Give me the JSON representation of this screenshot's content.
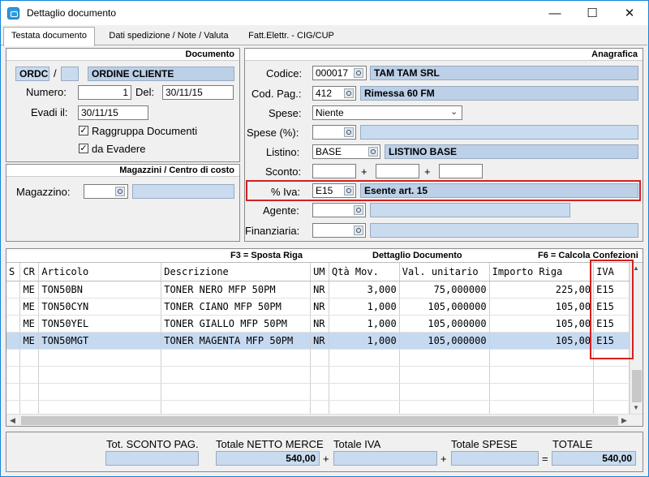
{
  "window": {
    "title": "Dettaglio documento",
    "minimize": "—",
    "maximize": "☐",
    "close": "✕"
  },
  "tabs": [
    {
      "label": "Testata documento",
      "active": true
    },
    {
      "label": "Dati spedizione / Note / Valuta",
      "active": false
    },
    {
      "label": "Fatt.Elettr. - CIG/CUP",
      "active": false
    }
  ],
  "documento": {
    "header": "Documento",
    "tipo": "ORDC",
    "separator": "/",
    "serie": "",
    "descrizione": "ORDINE CLIENTE",
    "numero_label": "Numero:",
    "numero": "1",
    "del_label": "Del:",
    "data": "30/11/15",
    "evadi_label": "Evadi il:",
    "evadi": "30/11/15",
    "raggruppa_label": "Raggruppa Documenti",
    "raggruppa_checked": true,
    "da_evadere_label": "da Evadere",
    "da_evadere_checked": true,
    "check_mark": "✓"
  },
  "magazzini": {
    "header": "Magazzini / Centro di costo",
    "magazzino_label": "Magazzino:",
    "magazzino": "",
    "magazzino_desc": ""
  },
  "anagrafica": {
    "header": "Anagrafica",
    "codice_label": "Codice:",
    "codice": "000017",
    "codice_desc": "TAM TAM SRL",
    "codpag_label": "Cod. Pag.:",
    "codpag": "412",
    "codpag_desc": "Rimessa 60 FM",
    "spese_label": "Spese:",
    "spese": "Niente",
    "spese_perc_label": "Spese (%):",
    "spese_perc": "",
    "listino_label": "Listino:",
    "listino": "BASE",
    "listino_desc": "LISTINO BASE",
    "sconto_label": "Sconto:",
    "sconto_plus": "+",
    "sconto1": "",
    "sconto2": "",
    "sconto3": "",
    "iva_label": "% Iva:",
    "iva": "E15",
    "iva_desc": "Esente art. 15",
    "agente_label": "Agente:",
    "agente": "",
    "finanziaria_label": "Finanziaria:",
    "finanziaria": ""
  },
  "grid": {
    "hint_left": "F3 = Sposta Riga",
    "hint_center": "Dettaglio Documento",
    "hint_right": "F6 = Calcola Confezioni",
    "columns": [
      "S",
      "CR",
      "Articolo",
      "Descrizione",
      "UM",
      "Qtà Mov.",
      "Val. unitario",
      "Importo Riga",
      "IVA"
    ],
    "rows": [
      {
        "s": "",
        "cr": "ME",
        "articolo": "TON50BN",
        "descrizione": "TONER NERO MFP 50PM",
        "um": "NR",
        "qta": "3,000",
        "val": "75,000000",
        "importo": "225,00",
        "iva": "E15",
        "selected": false
      },
      {
        "s": "",
        "cr": "ME",
        "articolo": "TON50CYN",
        "descrizione": "TONER CIANO MFP 50PM",
        "um": "NR",
        "qta": "1,000",
        "val": "105,000000",
        "importo": "105,00",
        "iva": "E15",
        "selected": false
      },
      {
        "s": "",
        "cr": "ME",
        "articolo": "TON50YEL",
        "descrizione": "TONER GIALLO MFP 50PM",
        "um": "NR",
        "qta": "1,000",
        "val": "105,000000",
        "importo": "105,00",
        "iva": "E15",
        "selected": false
      },
      {
        "s": "",
        "cr": "ME",
        "articolo": "TON50MGT",
        "descrizione": "TONER MAGENTA MFP 50PM",
        "um": "NR",
        "qta": "1,000",
        "val": "105,000000",
        "importo": "105,00",
        "iva": "E15",
        "selected": true
      }
    ],
    "scroll_left": "◀",
    "scroll_right": "▶",
    "scroll_up": "▲",
    "scroll_down": "▼"
  },
  "totali": {
    "sconto_pag_label": "Tot. SCONTO PAG.",
    "sconto_pag": "",
    "netto_merce_label": "Totale NETTO MERCE",
    "netto_merce": "540,00",
    "iva_label": "Totale IVA",
    "iva": "",
    "spese_label": "Totale SPESE",
    "spese": "",
    "totale_label": "TOTALE",
    "totale": "540,00",
    "plus": "+",
    "equals": "="
  },
  "colors": {
    "readonly_fill": "#bcd0e8",
    "highlight_red": "#d42020",
    "selection": "#c5d9f1",
    "window_border": "#1683d8"
  }
}
